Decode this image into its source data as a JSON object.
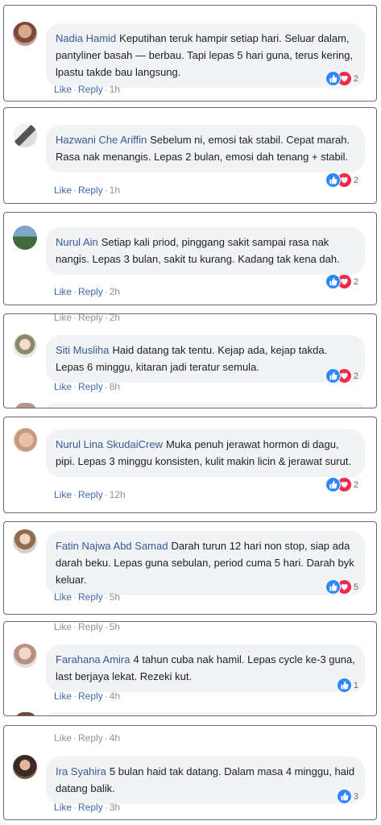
{
  "actions": {
    "like": "Like",
    "reply": "Reply",
    "sep": "·"
  },
  "colors": {
    "author": "#385898",
    "action": "#4267b2",
    "like": "#2d88ff",
    "love": "#f0284a"
  },
  "comments": [
    {
      "author": "Nadia Hamid",
      "text": "Keputihan teruk hampir setiap hari. Seluar dalam, pantyliner basah — berbau. Tapi lepas 5 hari guna, terus kering, lpastu takde bau langsung.",
      "time": "1h",
      "reactions": "2",
      "ghost_time": ""
    },
    {
      "author": "Hazwani Che Ariffin",
      "text": "Sebelum ni, emosi tak stabil. Cepat marah. Rasa nak menangis. Lepas 2 bulan, emosi dah tenang + stabil.",
      "time": "1h",
      "reactions": "2",
      "ghost_time": ""
    },
    {
      "author": "Nurul Ain",
      "text": "Setiap kali priod, pinggang sakit sampai rasa nak nangis. Lepas 3 bulan, sakit tu kurang. Kadang tak kena dah.",
      "time": "2h",
      "reactions": "2",
      "ghost_time": ""
    },
    {
      "author": "Siti Musliha",
      "text": "Haid datang tak tentu. Kejap ada, kejap takda. Lepas 6 minggu, kitaran jadi teratur semula.",
      "time": "8h",
      "reactions": "2",
      "ghost_time": "2h"
    },
    {
      "author": "Nurul Lina SkudaiCrew",
      "text": "Muka penuh jerawat hormon di dagu, pipi. Lepas 3 minggu konsisten, kulit makin licin & jerawat surut.",
      "time": "12h",
      "reactions": "2",
      "ghost_time": ""
    },
    {
      "author": "Fatin Najwa Abd Samad",
      "text": "Darah turun 12 hari non stop, siap ada darah beku. Lepas guna sebulan, period cuma 5 hari. Darah byk keluar.",
      "time": "5h",
      "reactions": "5",
      "ghost_time": ""
    },
    {
      "author": "Farahana Amira",
      "text": "4 tahun cuba nak hamil. Lepas cycle ke-3 guna, last berjaya lekat. Rezeki kut.",
      "time": "4h",
      "reactions": "1",
      "ghost_time": "5h"
    },
    {
      "author": "Ira Syahira",
      "text": "5 bulan haid tak datang. Dalam masa 4 minggu, haid datang balik.",
      "time": "3h",
      "reactions": "3",
      "ghost_time": "4h"
    }
  ]
}
